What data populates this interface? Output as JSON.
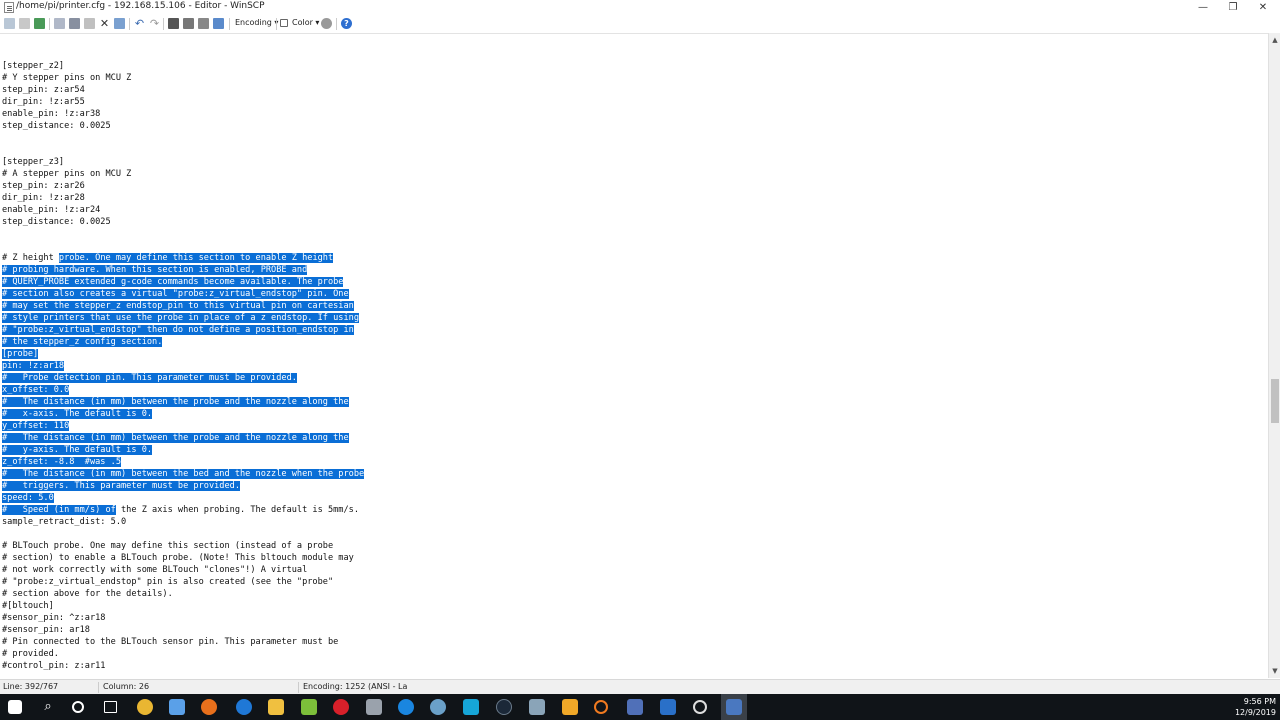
{
  "window": {
    "title": "/home/pi/printer.cfg - 192.168.15.106 - Editor - WinSCP",
    "minimize_glyph": "—",
    "maximize_glyph": "❐",
    "close_glyph": "✕"
  },
  "toolbar": {
    "encoding_label": "Encoding ▾",
    "color_label": "Color ▾"
  },
  "editor": {
    "lines": [
      {
        "pre": "[stepper_z2]",
        "sel": "",
        "post": ""
      },
      {
        "pre": "# Y stepper pins on MCU Z",
        "sel": "",
        "post": ""
      },
      {
        "pre": "step_pin: z:ar54",
        "sel": "",
        "post": ""
      },
      {
        "pre": "dir_pin: !z:ar55",
        "sel": "",
        "post": ""
      },
      {
        "pre": "enable_pin: !z:ar38",
        "sel": "",
        "post": ""
      },
      {
        "pre": "step_distance: 0.0025",
        "sel": "",
        "post": ""
      },
      {
        "pre": "",
        "sel": "",
        "post": ""
      },
      {
        "pre": "",
        "sel": "",
        "post": ""
      },
      {
        "pre": "[stepper_z3]",
        "sel": "",
        "post": ""
      },
      {
        "pre": "# A stepper pins on MCU Z",
        "sel": "",
        "post": ""
      },
      {
        "pre": "step_pin: z:ar26",
        "sel": "",
        "post": ""
      },
      {
        "pre": "dir_pin: !z:ar28",
        "sel": "",
        "post": ""
      },
      {
        "pre": "enable_pin: !z:ar24",
        "sel": "",
        "post": ""
      },
      {
        "pre": "step_distance: 0.0025",
        "sel": "",
        "post": ""
      },
      {
        "pre": "",
        "sel": "",
        "post": ""
      },
      {
        "pre": "",
        "sel": "",
        "post": ""
      },
      {
        "pre": "# Z height ",
        "sel": "probe. One may define this section to enable Z height",
        "post": ""
      },
      {
        "pre": "",
        "sel": "# probing hardware. When this section is enabled, PROBE and",
        "post": ""
      },
      {
        "pre": "",
        "sel": "# QUERY_PROBE extended g-code commands become available. The probe",
        "post": ""
      },
      {
        "pre": "",
        "sel": "# section also creates a virtual \"probe:z_virtual_endstop\" pin. One",
        "post": ""
      },
      {
        "pre": "",
        "sel": "# may set the stepper_z endstop_pin to this virtual pin on cartesian",
        "post": ""
      },
      {
        "pre": "",
        "sel": "# style printers that use the probe in place of a z endstop. If using",
        "post": ""
      },
      {
        "pre": "",
        "sel": "# \"probe:z_virtual_endstop\" then do not define a position_endstop in",
        "post": ""
      },
      {
        "pre": "",
        "sel": "# the stepper_z config section.",
        "post": ""
      },
      {
        "pre": "",
        "sel": "[probe]",
        "post": ""
      },
      {
        "pre": "",
        "sel": "pin: !z:ar18",
        "post": ""
      },
      {
        "pre": "",
        "sel": "#   Probe detection pin. This parameter must be provided.",
        "post": ""
      },
      {
        "pre": "",
        "sel": "x_offset: 0.0",
        "post": ""
      },
      {
        "pre": "",
        "sel": "#   The distance (in mm) between the probe and the nozzle along the",
        "post": ""
      },
      {
        "pre": "",
        "sel": "#   x-axis. The default is 0.",
        "post": ""
      },
      {
        "pre": "",
        "sel": "y_offset: 110",
        "post": ""
      },
      {
        "pre": "",
        "sel": "#   The distance (in mm) between the probe and the nozzle along the",
        "post": ""
      },
      {
        "pre": "",
        "sel": "#   y-axis. The default is 0.",
        "post": ""
      },
      {
        "pre": "",
        "sel": "z_offset: -8.8  #was .5",
        "post": ""
      },
      {
        "pre": "",
        "sel": "#   The distance (in mm) between the bed and the nozzle when the probe",
        "post": ""
      },
      {
        "pre": "",
        "sel": "#   triggers. This parameter must be provided.",
        "post": ""
      },
      {
        "pre": "",
        "sel": "speed: 5.0",
        "post": ""
      },
      {
        "pre": "",
        "sel": "#   Speed (in mm/s) of",
        "post": " the Z axis when probing. The default is 5mm/s."
      },
      {
        "pre": "sample_retract_dist: 5.0",
        "sel": "",
        "post": ""
      },
      {
        "pre": "",
        "sel": "",
        "post": ""
      },
      {
        "pre": "# BLTouch probe. One may define this section (instead of a probe",
        "sel": "",
        "post": ""
      },
      {
        "pre": "# section) to enable a BLTouch probe. (Note! This bltouch module may",
        "sel": "",
        "post": ""
      },
      {
        "pre": "# not work correctly with some BLTouch \"clones\"!) A virtual",
        "sel": "",
        "post": ""
      },
      {
        "pre": "# \"probe:z_virtual_endstop\" pin is also created (see the \"probe\"",
        "sel": "",
        "post": ""
      },
      {
        "pre": "# section above for the details).",
        "sel": "",
        "post": ""
      },
      {
        "pre": "#[bltouch]",
        "sel": "",
        "post": ""
      },
      {
        "pre": "#sensor_pin: ^z:ar18",
        "sel": "",
        "post": ""
      },
      {
        "pre": "#sensor_pin: ar18",
        "sel": "",
        "post": ""
      },
      {
        "pre": "# Pin connected to the BLTouch sensor pin. This parameter must be",
        "sel": "",
        "post": ""
      },
      {
        "pre": "# provided.",
        "sel": "",
        "post": ""
      },
      {
        "pre": "#control_pin: z:ar11",
        "sel": "",
        "post": ""
      }
    ]
  },
  "status": {
    "line": "Line: 392/767",
    "column": "Column: 26",
    "encoding": "Encoding: 1252  (ANSI - La"
  },
  "tray": {
    "time": "9:56 PM",
    "date": "12/9/2019"
  },
  "colors": {
    "selection": "#0a6ed6",
    "taskbar": "#101418"
  }
}
